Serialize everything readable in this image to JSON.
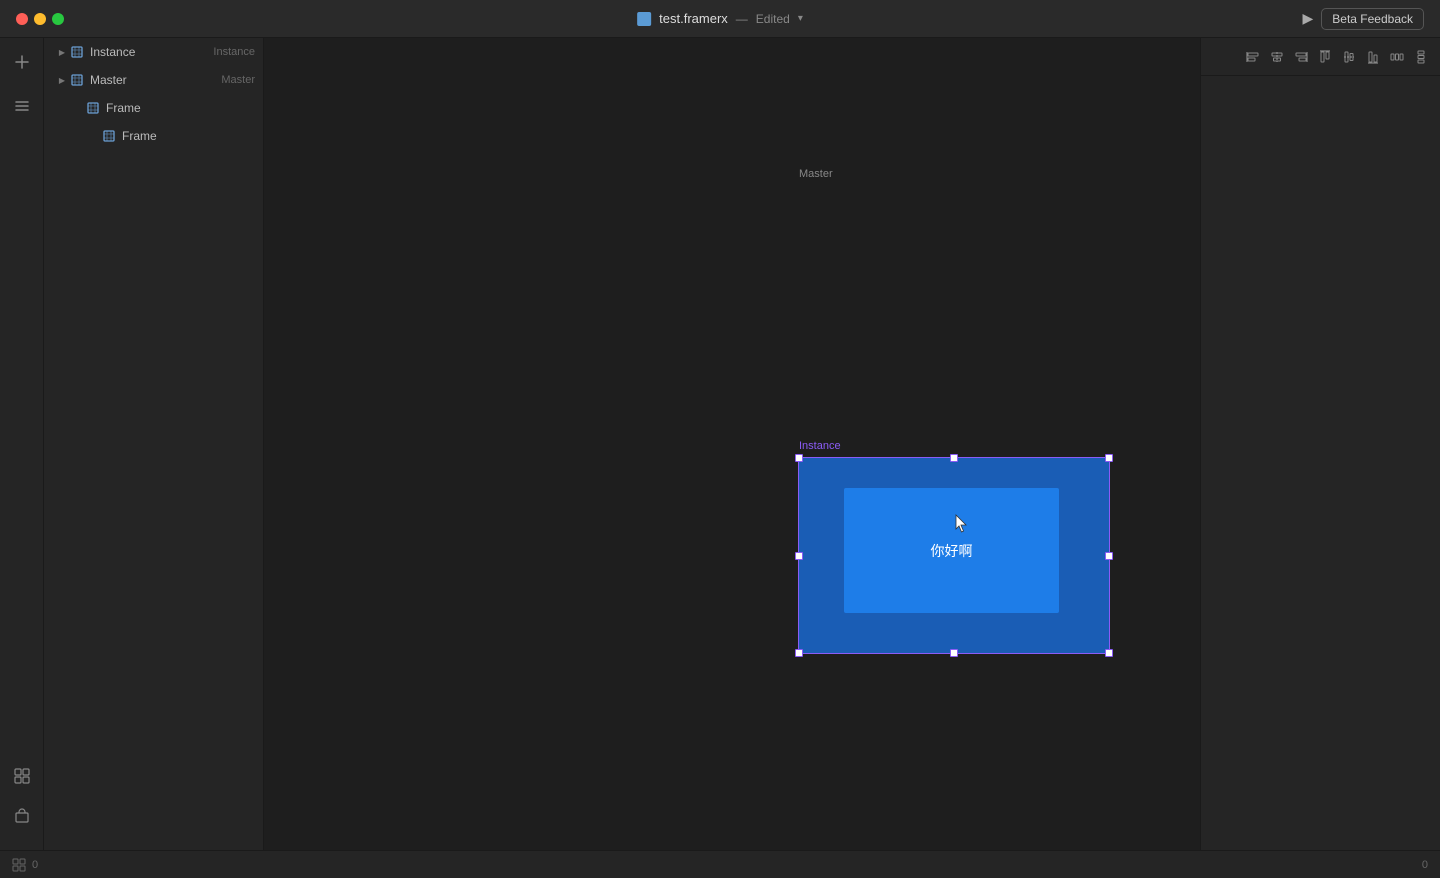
{
  "titlebar": {
    "filename": "test.framerx",
    "separator": "—",
    "edited_label": "Edited",
    "chevron": "▾",
    "play_icon": "▶",
    "beta_feedback_label": "Beta Feedback"
  },
  "sidebar_icons": {
    "add_icon": "+",
    "layers_icon": "≡",
    "components_icon": "⊞",
    "assets_icon": "🗂"
  },
  "layers": [
    {
      "id": "instance",
      "name": "Instance",
      "type": "Instance",
      "indent": 0,
      "has_arrow": true,
      "icon": "frame"
    },
    {
      "id": "master",
      "name": "Master",
      "type": "Master",
      "indent": 0,
      "has_arrow": true,
      "icon": "frame"
    },
    {
      "id": "frame1",
      "name": "Frame",
      "type": "",
      "indent": 0,
      "has_arrow": false,
      "icon": "frame"
    },
    {
      "id": "frame2",
      "name": "Frame",
      "type": "",
      "indent": 1,
      "has_arrow": false,
      "icon": "frame"
    }
  ],
  "canvas": {
    "master_label": "Master",
    "instance_label": "Instance",
    "text_content": "你好啊",
    "master_bg": "#1a5db5",
    "master_inner_bg": "#1e7de8",
    "instance_bg": "#1a5db5",
    "instance_inner_bg": "#1e7de8",
    "selection_color": "#8b5cf6"
  },
  "right_panel": {
    "toolbar_icons": [
      "⊢",
      "⊣",
      "⊤",
      "⊥",
      "⊞",
      "⊟",
      "⊠",
      "⊡"
    ]
  },
  "statusbar": {
    "left": "0",
    "right": "0"
  }
}
